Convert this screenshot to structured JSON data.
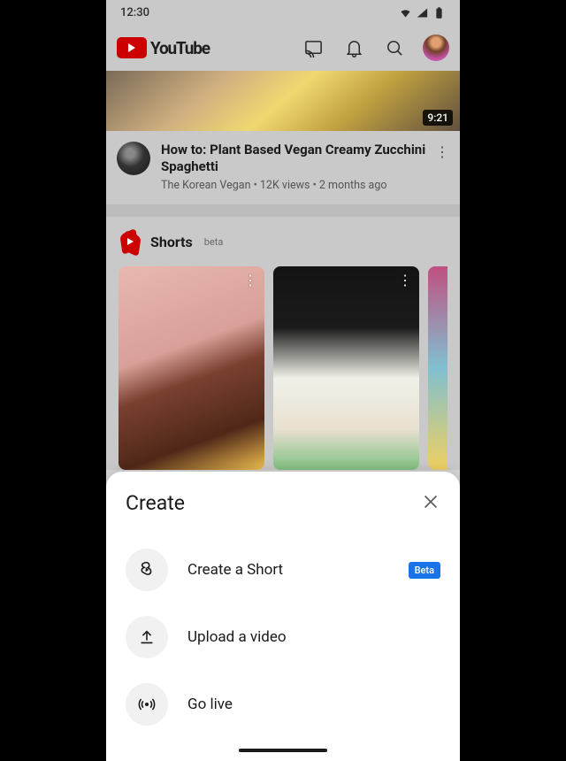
{
  "status": {
    "time": "12:30"
  },
  "header": {
    "brand": "YouTube"
  },
  "feed": {
    "video": {
      "duration": "9:21",
      "title": "How to: Plant Based Vegan Creamy Zucchini Spaghetti",
      "channel": "The Korean Vegan",
      "views": "12K views",
      "age": "2 months ago"
    },
    "shorts": {
      "heading": "Shorts",
      "badge": "beta"
    }
  },
  "sheet": {
    "title": "Create",
    "items": [
      {
        "label": "Create a Short",
        "badge": "Beta"
      },
      {
        "label": "Upload a video"
      },
      {
        "label": "Go live"
      }
    ]
  }
}
